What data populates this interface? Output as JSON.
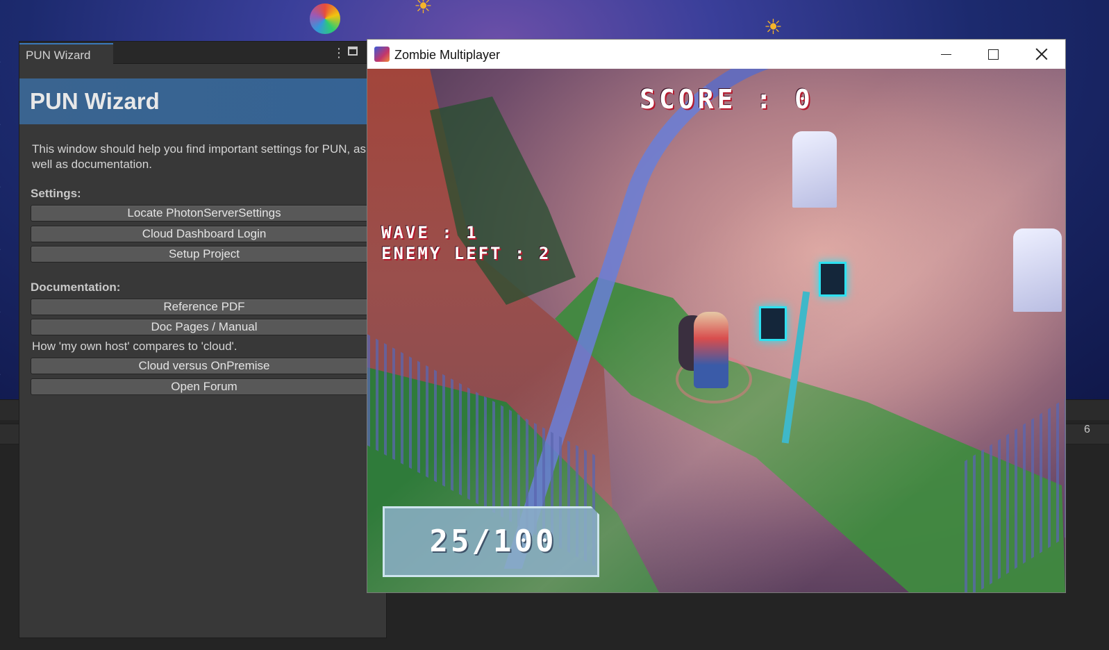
{
  "pun_wizard": {
    "tab_label": "PUN Wizard",
    "header_title": "PUN Wizard",
    "description": "This window should help you find important settings for PUN, as well as documentation.",
    "settings_label": "Settings:",
    "settings_buttons": [
      "Locate PhotonServerSettings",
      "Cloud Dashboard Login",
      "Setup Project"
    ],
    "documentation_label": "Documentation:",
    "doc_buttons": [
      "Reference PDF",
      "Doc Pages / Manual"
    ],
    "hosting_note": "How 'my own host' compares to 'cloud'.",
    "hosting_buttons": [
      "Cloud versus OnPremise",
      "Open Forum"
    ]
  },
  "game_window": {
    "title": "Zombie Multiplayer",
    "hud": {
      "score": "SCORE : 0",
      "wave": "WAVE : 1",
      "enemy_left": "ENEMY LEFT : 2",
      "ammo": "25/100"
    }
  },
  "editor": {
    "partial_number": "6"
  },
  "colors": {
    "pun_header": "#3a6490",
    "tab_accent": "#3a79bb",
    "hud_shadow": "#b4182c"
  },
  "icons": [
    "more-vert-icon",
    "maximize-panel-icon",
    "app-icon",
    "minimize-icon",
    "maximize-icon",
    "close-icon"
  ]
}
